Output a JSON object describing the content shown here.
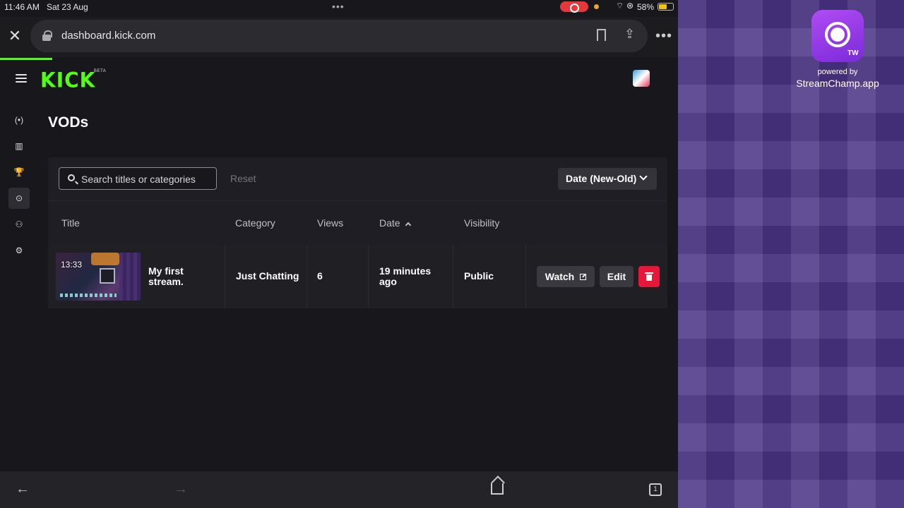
{
  "statusbar": {
    "time": "11:46 AM",
    "date": "Sat 23 Aug",
    "battery": "58%"
  },
  "browser": {
    "url": "dashboard.kick.com"
  },
  "header": {
    "logo": "KICK",
    "beta": "BETA"
  },
  "sidebar": {
    "items": [
      {
        "name": "live-icon",
        "glyph": "(•)"
      },
      {
        "name": "analytics-icon",
        "glyph": "▥"
      },
      {
        "name": "trophy-icon",
        "glyph": "🏆"
      },
      {
        "name": "vods-icon",
        "glyph": "⊙"
      },
      {
        "name": "community-icon",
        "glyph": "⚇"
      },
      {
        "name": "settings-icon",
        "glyph": "⚙"
      }
    ],
    "active_index": 3
  },
  "page": {
    "title": "VODs"
  },
  "toolbar": {
    "search_placeholder": "Search titles or categories",
    "reset_label": "Reset",
    "sort_label": "Date (New-Old)"
  },
  "table": {
    "columns": {
      "title": "Title",
      "category": "Category",
      "views": "Views",
      "date": "Date",
      "visibility": "Visibility"
    },
    "rows": [
      {
        "duration": "13:33",
        "title": "My first stream.",
        "category": "Just Chatting",
        "views": "6",
        "date": "19 minutes ago",
        "visibility": "Public",
        "watch_label": "Watch",
        "edit_label": "Edit"
      }
    ]
  },
  "overlay": {
    "badge": "TW",
    "powered_by": "powered by",
    "app_name": "StreamChamp.app"
  },
  "colors": {
    "kick_green": "#53fc18",
    "delete_red": "#e8173a",
    "overlay_purple": "#4a3485"
  }
}
